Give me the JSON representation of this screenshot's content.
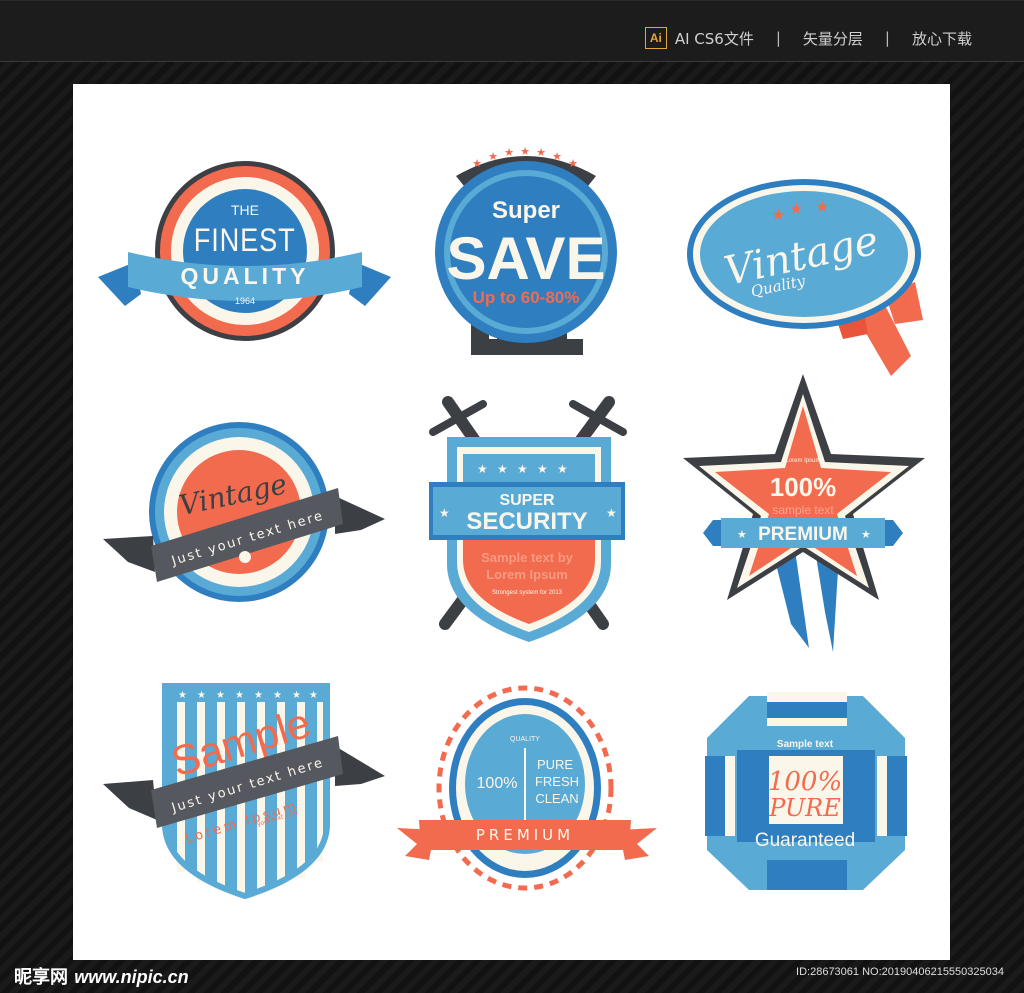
{
  "header": {
    "ai_icon_label": "Ai",
    "format_label": "AI CS6文件",
    "separator": "|",
    "vector_label": "矢量分层",
    "download_label": "放心下载"
  },
  "badges": {
    "finest": {
      "line1": "THE",
      "line2": "FINEST",
      "ribbon": "QUALITY",
      "year": "1964"
    },
    "save": {
      "line1": "Super",
      "line2": "SAVE",
      "line3": "Up to 60-80%"
    },
    "vintage_oval": {
      "script": "Vintage",
      "sub": "Quality"
    },
    "vintage_circle": {
      "script": "Vintage",
      "ribbon": "Just your text here"
    },
    "security": {
      "line1": "SUPER",
      "line2": "SECURITY",
      "sample1": "Sample text by",
      "sample2": "Lorem Ipsum",
      "tiny": "Strongest system for 2013"
    },
    "star": {
      "tiny": "Lorem Ipsum",
      "big": "100%",
      "sample": "sample text",
      "ribbon": "PREMIUM"
    },
    "shield": {
      "script": "Sample",
      "ribbon": "Just your text here",
      "lorem": "Lorem Ipsum",
      "tiny": "your text here"
    },
    "pure": {
      "quality": "QUALITY",
      "pct": "100%",
      "pure": "PURE",
      "fresh": "FRESH",
      "clean": "CLEAN",
      "ribbon": "PREMIUM"
    },
    "octagon": {
      "sample": "Sample text",
      "pct": "100%",
      "pure": "PURE",
      "guaranteed": "Guaranteed"
    }
  },
  "footer": {
    "site_cn": "昵享网",
    "url": "www.nipic.cn",
    "id_text": "ID:28673061 NO:20190406215550325034"
  },
  "colors": {
    "blue": "#2f7fc0",
    "dark_blue": "#1f67aa",
    "light_blue": "#5aaad6",
    "coral": "#f26b4e",
    "charcoal": "#3c3f44",
    "cream": "#fbf6ea"
  }
}
